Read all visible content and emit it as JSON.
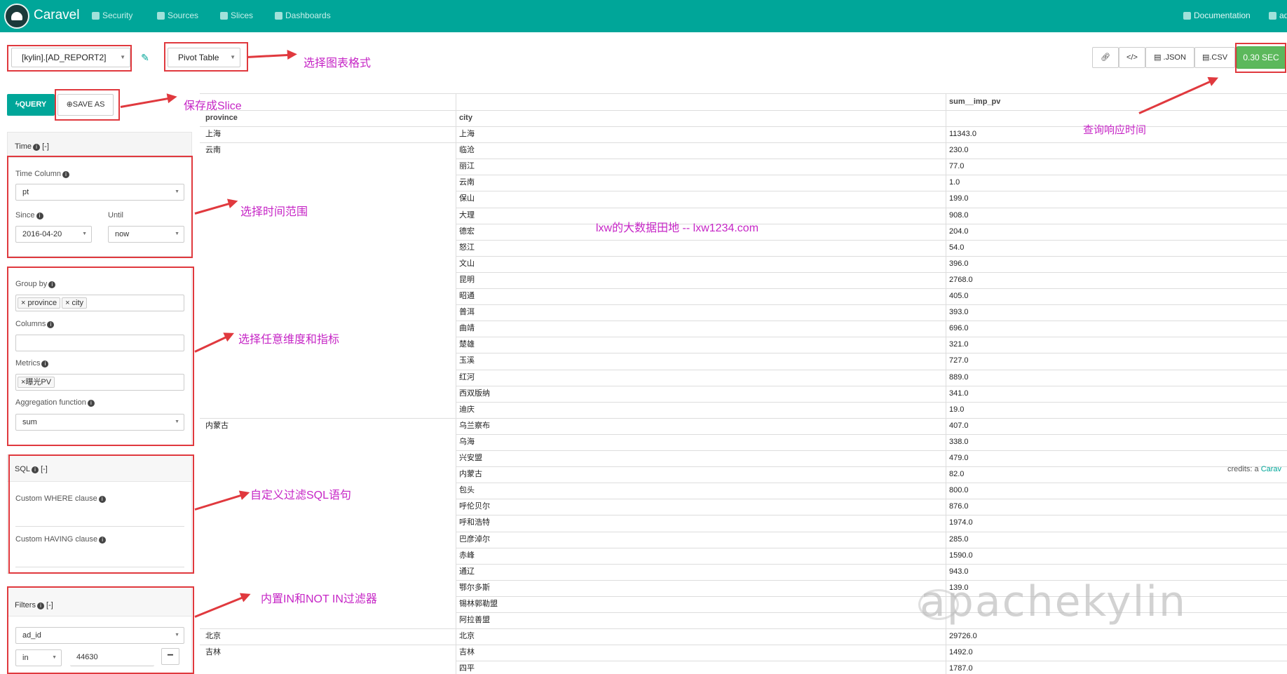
{
  "nav": {
    "brand": "Caravel",
    "security": "Security",
    "sources": "Sources",
    "slices": "Slices",
    "dashboards": "Dashboards",
    "documentation": "Documentation",
    "user": "ad"
  },
  "toolbar": {
    "datasource": "[kylin].[AD_REPORT2]",
    "viz_type": "Pivot Table",
    "json": ".JSON",
    "csv": ".CSV",
    "timer": "0.30 SEC",
    "query": "QUERY",
    "save_as": "SAVE AS"
  },
  "annotations": {
    "chart_format": "选择图表格式",
    "save_slice": "保存成Slice",
    "time_range": "选择时间范围",
    "dims_metrics": "选择任意维度和指标",
    "sql_filter": "自定义过滤SQL语句",
    "in_filter": "内置IN和NOT IN过滤器",
    "response_time": "查询响应时间",
    "site": "lxw的大数据田地 -- lxw1234.com"
  },
  "time": {
    "header": "Time",
    "toggle": "[-]",
    "time_column_label": "Time Column",
    "time_column": "pt",
    "since_label": "Since",
    "since": "2016-04-20",
    "until_label": "Until",
    "until": "now"
  },
  "group": {
    "group_by_label": "Group by",
    "group_by_tags": [
      "province",
      "city"
    ],
    "columns_label": "Columns",
    "metrics_label": "Metrics",
    "metrics_tag": "曝光PV",
    "agg_label": "Aggregation function",
    "agg": "sum"
  },
  "sql": {
    "header": "SQL",
    "toggle": "[-]",
    "where_label": "Custom WHERE clause",
    "having_label": "Custom HAVING clause"
  },
  "filters": {
    "header": "Filters",
    "toggle": "[-]",
    "column": "ad_id",
    "op": "in",
    "value": "44630",
    "remove": "−"
  },
  "table": {
    "headers": {
      "province": "province",
      "city": "city",
      "metric": "sum__imp_pv"
    },
    "rows": [
      [
        "上海",
        "上海",
        "11343.0"
      ],
      [
        "云南",
        "临沧",
        "230.0"
      ],
      [
        "",
        "丽江",
        "77.0"
      ],
      [
        "",
        "云南",
        "1.0"
      ],
      [
        "",
        "保山",
        "199.0"
      ],
      [
        "",
        "大理",
        "908.0"
      ],
      [
        "",
        "德宏",
        "204.0"
      ],
      [
        "",
        "怒江",
        "54.0"
      ],
      [
        "",
        "文山",
        "396.0"
      ],
      [
        "",
        "昆明",
        "2768.0"
      ],
      [
        "",
        "昭通",
        "405.0"
      ],
      [
        "",
        "普洱",
        "393.0"
      ],
      [
        "",
        "曲靖",
        "696.0"
      ],
      [
        "",
        "楚雄",
        "321.0"
      ],
      [
        "",
        "玉溪",
        "727.0"
      ],
      [
        "",
        "红河",
        "889.0"
      ],
      [
        "",
        "西双版纳",
        "341.0"
      ],
      [
        "",
        "迪庆",
        "19.0"
      ],
      [
        "内蒙古",
        "乌兰察布",
        "407.0"
      ],
      [
        "",
        "乌海",
        "338.0"
      ],
      [
        "",
        "兴安盟",
        "479.0"
      ],
      [
        "",
        "内蒙古",
        "82.0"
      ],
      [
        "",
        "包头",
        "800.0"
      ],
      [
        "",
        "呼伦贝尔",
        "876.0"
      ],
      [
        "",
        "呼和浩特",
        "1974.0"
      ],
      [
        "",
        "巴彦淖尔",
        "285.0"
      ],
      [
        "",
        "赤峰",
        "1590.0"
      ],
      [
        "",
        "通辽",
        "943.0"
      ],
      [
        "",
        "鄂尔多斯",
        "139.0"
      ],
      [
        "",
        "锡林郭勒盟",
        ""
      ],
      [
        "",
        "阿拉善盟",
        ""
      ],
      [
        "北京",
        "北京",
        "29726.0"
      ],
      [
        "吉林",
        "吉林",
        "1492.0"
      ],
      [
        "",
        "四平",
        "1787.0"
      ]
    ],
    "credits": "credits: a ",
    "credits_link": "Carav"
  },
  "watermark": "apachekylin"
}
